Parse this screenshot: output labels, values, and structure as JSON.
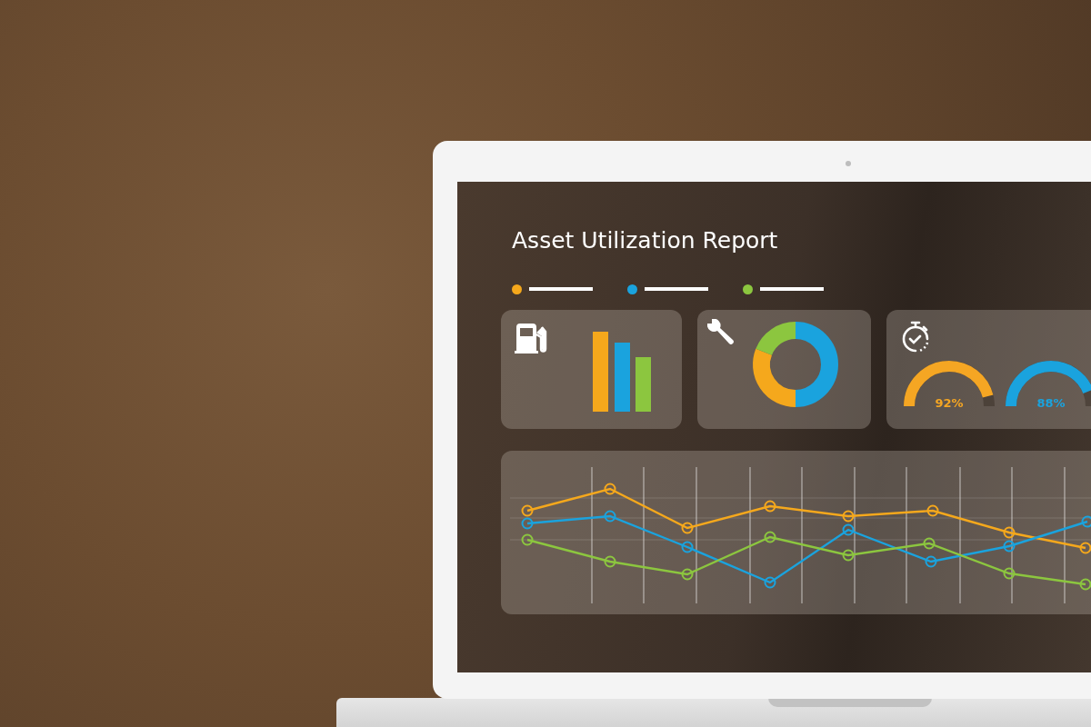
{
  "report": {
    "title": "Asset Utilization Report",
    "legend": [
      {
        "color": "#f5a81c"
      },
      {
        "color": "#1aa3de"
      },
      {
        "color": "#8cc63f"
      }
    ],
    "cards": [
      {
        "kind": "bars"
      },
      {
        "kind": "donut"
      },
      {
        "kind": "gauges",
        "gauges": [
          {
            "reading": "92%",
            "level": 0.92,
            "color": "#f5a623"
          },
          {
            "reading": "88%",
            "level": 0.88,
            "color": "#1aa3de"
          }
        ]
      }
    ]
  }
}
